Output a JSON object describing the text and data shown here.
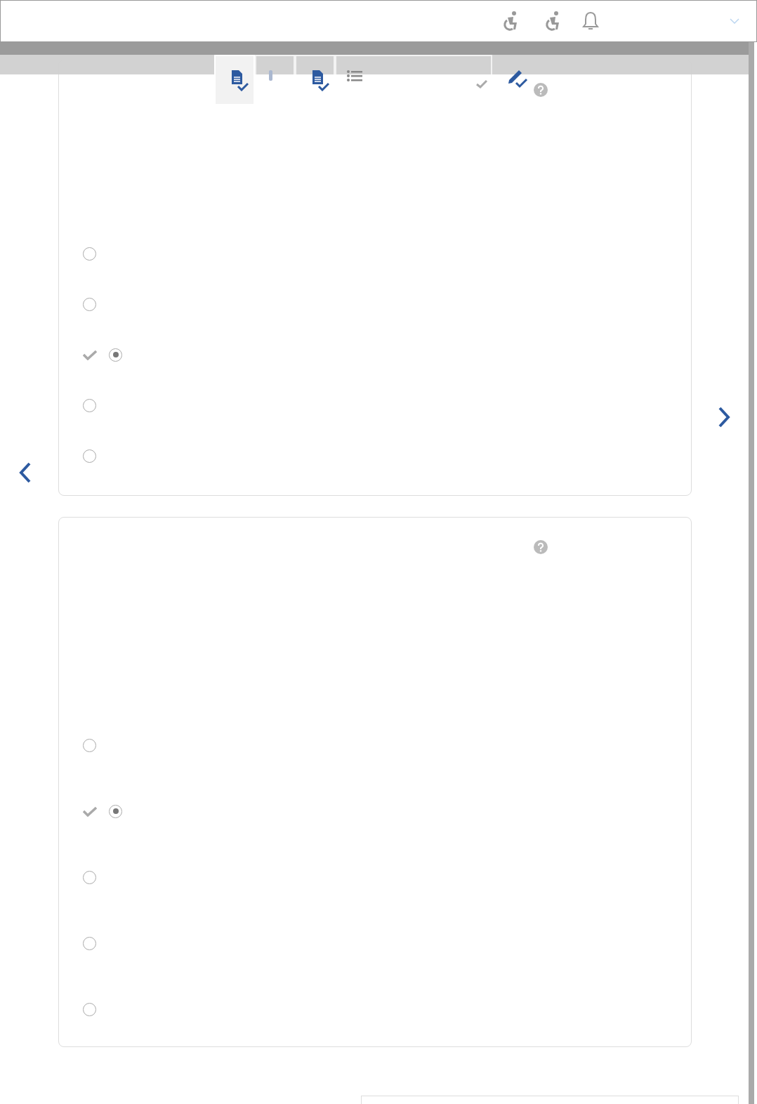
{
  "toolbar": {
    "tabs": [
      {
        "selected": true
      },
      {
        "selected": false
      },
      {
        "selected": false
      },
      {
        "selected": false
      }
    ]
  },
  "questions": [
    {
      "options": [
        {
          "selected": false
        },
        {
          "selected": false
        },
        {
          "selected": true
        },
        {
          "selected": false
        },
        {
          "selected": false
        }
      ]
    },
    {
      "options": [
        {
          "selected": false
        },
        {
          "selected": true
        },
        {
          "selected": false
        },
        {
          "selected": false
        },
        {
          "selected": false
        }
      ]
    }
  ]
}
